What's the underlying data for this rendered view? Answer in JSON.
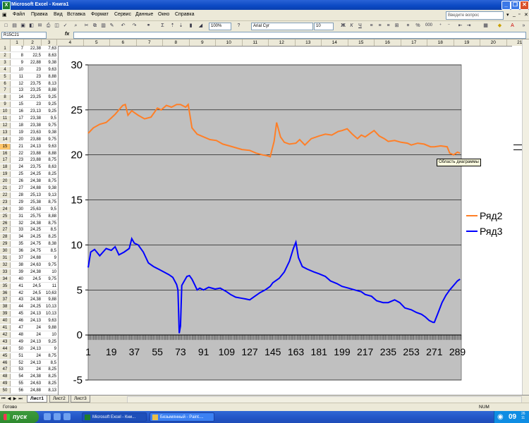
{
  "window": {
    "title": "Microsoft Excel - Книга1"
  },
  "menu": {
    "items": [
      "Файл",
      "Правка",
      "Вид",
      "Вставка",
      "Формат",
      "Сервис",
      "Данные",
      "Окно",
      "Справка"
    ],
    "ask_placeholder": "Введите вопрос"
  },
  "toolbar": {
    "zoom": "100%",
    "font_name": "Arial Cyr",
    "font_size": "10",
    "percent_btn": "%",
    "format_000": "000"
  },
  "formula_bar": {
    "name_box": "R15C21",
    "fx_label": "fx"
  },
  "columns": [
    "1",
    "2",
    "3",
    "4",
    "5",
    "6",
    "7",
    "8",
    "9",
    "10",
    "11",
    "12",
    "13",
    "14",
    "15",
    "16",
    "17",
    "18",
    "19",
    "20",
    "21"
  ],
  "rows": [
    [
      "1",
      "7",
      "22,38",
      "7,63"
    ],
    [
      "2",
      "8",
      "22,5",
      "8,63"
    ],
    [
      "3",
      "9",
      "22,88",
      "9,38"
    ],
    [
      "4",
      "10",
      "23",
      "9,63"
    ],
    [
      "5",
      "11",
      "23",
      "8,88"
    ],
    [
      "6",
      "12",
      "23,75",
      "8,13"
    ],
    [
      "7",
      "13",
      "23,25",
      "8,88"
    ],
    [
      "8",
      "14",
      "23,25",
      "9,25"
    ],
    [
      "9",
      "15",
      "23",
      "9,25"
    ],
    [
      "10",
      "16",
      "23,13",
      "9,25"
    ],
    [
      "11",
      "17",
      "23,38",
      "9,5"
    ],
    [
      "12",
      "18",
      "23,38",
      "9,75"
    ],
    [
      "13",
      "19",
      "23,63",
      "9,38"
    ],
    [
      "14",
      "20",
      "23,88",
      "9,75"
    ],
    [
      "15",
      "21",
      "24,13",
      "9,63"
    ],
    [
      "16",
      "22",
      "23,88",
      "8,88"
    ],
    [
      "17",
      "23",
      "23,88",
      "8,75"
    ],
    [
      "18",
      "24",
      "23,75",
      "8,63"
    ],
    [
      "19",
      "25",
      "24,25",
      "8,25"
    ],
    [
      "20",
      "26",
      "24,38",
      "8,75"
    ],
    [
      "21",
      "27",
      "24,88",
      "9,38"
    ],
    [
      "22",
      "28",
      "25,13",
      "9,13"
    ],
    [
      "23",
      "29",
      "25,38",
      "8,75"
    ],
    [
      "24",
      "30",
      "25,63",
      "9,5"
    ],
    [
      "25",
      "31",
      "25,75",
      "8,88"
    ],
    [
      "26",
      "32",
      "24,38",
      "8,75"
    ],
    [
      "27",
      "33",
      "24,25",
      "8,5"
    ],
    [
      "28",
      "34",
      "24,25",
      "8,25"
    ],
    [
      "29",
      "35",
      "24,75",
      "8,38"
    ],
    [
      "30",
      "36",
      "24,75",
      "8,5"
    ],
    [
      "31",
      "37",
      "24,88",
      "9"
    ],
    [
      "32",
      "38",
      "24,63",
      "9,75"
    ],
    [
      "33",
      "39",
      "24,38",
      "10"
    ],
    [
      "34",
      "40",
      "24,5",
      "9,75"
    ],
    [
      "35",
      "41",
      "24,5",
      "11"
    ],
    [
      "36",
      "42",
      "24,5",
      "10,63"
    ],
    [
      "37",
      "43",
      "24,38",
      "9,88"
    ],
    [
      "38",
      "44",
      "24,25",
      "10,13"
    ],
    [
      "39",
      "45",
      "24,13",
      "10,13"
    ],
    [
      "40",
      "46",
      "24,13",
      "9,63"
    ],
    [
      "41",
      "47",
      "24",
      "9,88"
    ],
    [
      "42",
      "48",
      "24",
      "10"
    ],
    [
      "43",
      "49",
      "24,13",
      "9,25"
    ],
    [
      "44",
      "50",
      "24,13",
      "9"
    ],
    [
      "45",
      "51",
      "24",
      "8,75"
    ],
    [
      "46",
      "52",
      "24,13",
      "8,5"
    ],
    [
      "47",
      "53",
      "24",
      "8,25"
    ],
    [
      "48",
      "54",
      "24,38",
      "8,25"
    ],
    [
      "49",
      "55",
      "24,63",
      "8,25"
    ],
    [
      "50",
      "56",
      "24,88",
      "8,13"
    ]
  ],
  "selected_row_label": "15",
  "chart_data": {
    "type": "line",
    "ylim": [
      -5,
      30
    ],
    "yticks": [
      "-5",
      "0",
      "5",
      "10",
      "15",
      "20",
      "25",
      "30"
    ],
    "xticks": [
      "1",
      "19",
      "37",
      "55",
      "73",
      "91",
      "109",
      "127",
      "145",
      "163",
      "181",
      "199",
      "217",
      "235",
      "253",
      "271",
      "289"
    ],
    "x_range": [
      1,
      292
    ],
    "legend_position": "right",
    "grid": "horizontal",
    "series": [
      {
        "name": "Ряд2",
        "color": "#ff7f27",
        "points": [
          [
            1,
            22.4
          ],
          [
            5,
            23.0
          ],
          [
            10,
            23.4
          ],
          [
            15,
            23.6
          ],
          [
            19,
            24.1
          ],
          [
            22,
            24.5
          ],
          [
            25,
            25.0
          ],
          [
            28,
            25.5
          ],
          [
            30,
            25.6
          ],
          [
            32,
            24.4
          ],
          [
            35,
            24.9
          ],
          [
            37,
            24.7
          ],
          [
            40,
            24.4
          ],
          [
            45,
            24.0
          ],
          [
            50,
            24.2
          ],
          [
            55,
            25.2
          ],
          [
            58,
            25.0
          ],
          [
            62,
            25.5
          ],
          [
            66,
            25.3
          ],
          [
            70,
            25.6
          ],
          [
            73,
            25.6
          ],
          [
            77,
            25.3
          ],
          [
            79,
            25.6
          ],
          [
            82,
            23.0
          ],
          [
            86,
            22.3
          ],
          [
            91,
            22.0
          ],
          [
            96,
            21.7
          ],
          [
            101,
            21.6
          ],
          [
            106,
            21.2
          ],
          [
            111,
            21.0
          ],
          [
            116,
            20.8
          ],
          [
            121,
            20.6
          ],
          [
            127,
            20.5
          ],
          [
            132,
            20.2
          ],
          [
            137,
            20.0
          ],
          [
            141,
            19.9
          ],
          [
            143,
            19.8
          ],
          [
            146,
            21.5
          ],
          [
            148,
            23.6
          ],
          [
            151,
            22.0
          ],
          [
            154,
            21.4
          ],
          [
            158,
            21.2
          ],
          [
            163,
            21.3
          ],
          [
            166,
            21.7
          ],
          [
            170,
            21.1
          ],
          [
            175,
            21.8
          ],
          [
            181,
            22.1
          ],
          [
            186,
            22.3
          ],
          [
            191,
            22.2
          ],
          [
            196,
            22.6
          ],
          [
            199,
            22.7
          ],
          [
            203,
            22.9
          ],
          [
            207,
            22.3
          ],
          [
            211,
            21.8
          ],
          [
            214,
            22.2
          ],
          [
            217,
            22.0
          ],
          [
            220,
            22.3
          ],
          [
            224,
            22.7
          ],
          [
            228,
            22.1
          ],
          [
            232,
            21.8
          ],
          [
            235,
            21.5
          ],
          [
            240,
            21.6
          ],
          [
            245,
            21.4
          ],
          [
            250,
            21.3
          ],
          [
            253,
            21.1
          ],
          [
            258,
            21.3
          ],
          [
            263,
            21.2
          ],
          [
            268,
            20.9
          ],
          [
            271,
            20.9
          ],
          [
            276,
            21.0
          ],
          [
            281,
            20.9
          ],
          [
            283,
            20.2
          ],
          [
            286,
            20.0
          ],
          [
            289,
            20.3
          ],
          [
            291,
            20.2
          ]
        ]
      },
      {
        "name": "Ряд3",
        "color": "#0000ff",
        "points": [
          [
            1,
            7.5
          ],
          [
            3,
            9.2
          ],
          [
            6,
            9.5
          ],
          [
            10,
            8.8
          ],
          [
            15,
            9.6
          ],
          [
            19,
            9.4
          ],
          [
            22,
            9.8
          ],
          [
            25,
            8.9
          ],
          [
            29,
            9.2
          ],
          [
            33,
            9.6
          ],
          [
            35,
            10.7
          ],
          [
            37,
            10.2
          ],
          [
            40,
            10.0
          ],
          [
            44,
            9.2
          ],
          [
            48,
            8.0
          ],
          [
            52,
            7.6
          ],
          [
            56,
            7.3
          ],
          [
            60,
            7.0
          ],
          [
            64,
            6.7
          ],
          [
            67,
            6.4
          ],
          [
            70,
            5.6
          ],
          [
            71,
            5.0
          ],
          [
            72,
            0.2
          ],
          [
            73,
            1.0
          ],
          [
            74,
            5.5
          ],
          [
            76,
            6.0
          ],
          [
            78,
            6.5
          ],
          [
            80,
            6.6
          ],
          [
            82,
            6.2
          ],
          [
            84,
            5.6
          ],
          [
            86,
            5.0
          ],
          [
            88,
            5.2
          ],
          [
            91,
            5.0
          ],
          [
            95,
            5.3
          ],
          [
            100,
            5.1
          ],
          [
            104,
            5.2
          ],
          [
            109,
            4.8
          ],
          [
            112,
            4.5
          ],
          [
            116,
            4.2
          ],
          [
            120,
            4.1
          ],
          [
            124,
            4.0
          ],
          [
            127,
            3.9
          ],
          [
            131,
            4.3
          ],
          [
            135,
            4.7
          ],
          [
            139,
            5.0
          ],
          [
            143,
            5.4
          ],
          [
            145,
            5.8
          ],
          [
            150,
            6.3
          ],
          [
            154,
            7.0
          ],
          [
            158,
            8.2
          ],
          [
            161,
            9.6
          ],
          [
            163,
            10.3
          ],
          [
            165,
            8.6
          ],
          [
            168,
            7.6
          ],
          [
            172,
            7.3
          ],
          [
            177,
            7.0
          ],
          [
            181,
            6.8
          ],
          [
            186,
            6.5
          ],
          [
            190,
            6.0
          ],
          [
            195,
            5.7
          ],
          [
            199,
            5.4
          ],
          [
            204,
            5.2
          ],
          [
            209,
            5.0
          ],
          [
            214,
            4.8
          ],
          [
            217,
            4.5
          ],
          [
            222,
            4.3
          ],
          [
            226,
            3.8
          ],
          [
            231,
            3.6
          ],
          [
            235,
            3.6
          ],
          [
            240,
            3.9
          ],
          [
            244,
            3.6
          ],
          [
            248,
            3.0
          ],
          [
            253,
            2.8
          ],
          [
            257,
            2.5
          ],
          [
            261,
            2.3
          ],
          [
            264,
            2.0
          ],
          [
            267,
            1.6
          ],
          [
            270,
            1.4
          ],
          [
            271,
            1.4
          ],
          [
            274,
            2.5
          ],
          [
            277,
            3.6
          ],
          [
            280,
            4.4
          ],
          [
            283,
            5.0
          ],
          [
            286,
            5.5
          ],
          [
            289,
            6.0
          ],
          [
            291,
            6.2
          ]
        ]
      }
    ]
  },
  "tooltip": "Область диаграммы",
  "sheet_tabs": [
    "Лист1",
    "Лист2",
    "Лист3"
  ],
  "status": {
    "ready": "Готово",
    "num": "NUM"
  },
  "taskbar": {
    "start": "пуск",
    "tasks": [
      "Microsoft Excel - Кни...",
      "Безымянный - Paint...."
    ],
    "clock": "09",
    "clock_small": "26\n11"
  },
  "colors": {
    "title_bar": "#0b49c4",
    "plot_area": "#c0c0c0",
    "series2": "#ff7f27",
    "series3": "#0000ff",
    "taskbar": "#2457c8",
    "start_button": "#2e8a2e"
  }
}
